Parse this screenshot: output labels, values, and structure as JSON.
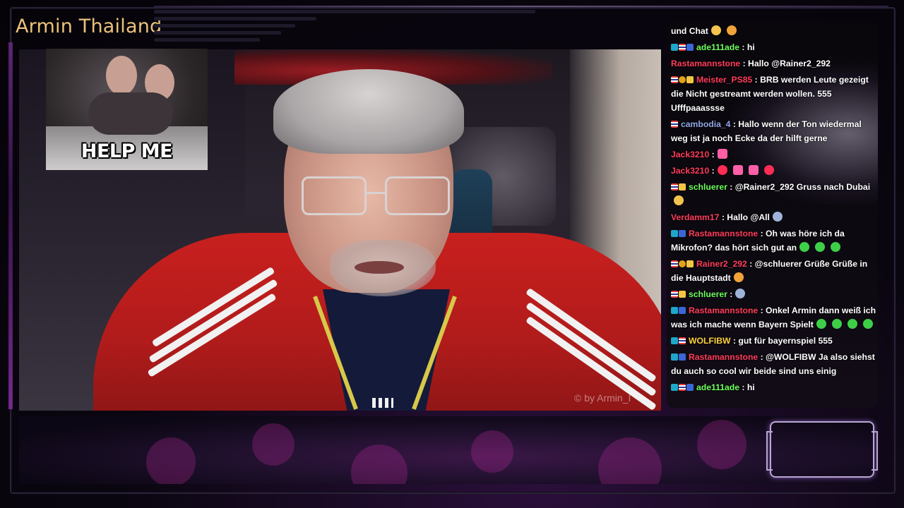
{
  "stream": {
    "title": "Armin Thailand",
    "watermark": "© by Armin_I",
    "gif_caption": "HELP ME"
  },
  "chat": {
    "messages": [
      {
        "badges": [],
        "user": "",
        "user_color": "#ffffff",
        "text": "und Chat",
        "emotes": [
          "e-hand",
          "e-face"
        ]
      },
      {
        "badges": [
          "b-cyan",
          "b-flag",
          "b-blue"
        ],
        "user": "ade111ade",
        "user_color": "#6bff5a",
        "text": ": hi",
        "emotes": []
      },
      {
        "badges": [],
        "user": "Rastamannstone",
        "user_color": "#ff3c5a",
        "text": ": Hallo @Rainer2_292",
        "emotes": []
      },
      {
        "badges": [
          "b-flag",
          "b-gold",
          "b-crown"
        ],
        "user": "Meister_PS85",
        "user_color": "#ff3c5a",
        "text": ": BRB werden Leute gezeigt die Nicht gestreamt werden wollen. 555 Ufffpaaassse",
        "emotes": []
      },
      {
        "badges": [
          "b-flag"
        ],
        "user": "cambodia_4",
        "user_color": "#8fa7e6",
        "text": ": Hallo wenn der Ton wiedermal weg ist ja noch Ecke da der hilft gerne",
        "emotes": []
      },
      {
        "badges": [],
        "user": "Jack3210",
        "user_color": "#ff3c5a",
        "text": ":",
        "emotes": [
          "e-pink"
        ]
      },
      {
        "badges": [],
        "user": "Jack3210",
        "user_color": "#ff3c5a",
        "text": ":",
        "emotes": [
          "e-red",
          "e-pink",
          "e-pink",
          "e-red"
        ]
      },
      {
        "badges": [
          "b-flag",
          "b-crown"
        ],
        "user": "schluerer",
        "user_color": "#6bff5a",
        "text": ": @Rainer2_292 Gruss nach Dubai",
        "emotes": [
          "e-hand"
        ]
      },
      {
        "badges": [],
        "user": "Verdamm17",
        "user_color": "#ff3c5a",
        "text": ": Hallo @All",
        "emotes": [
          "e-face2"
        ]
      },
      {
        "badges": [
          "b-cyan",
          "b-blue"
        ],
        "user": "Rastamannstone",
        "user_color": "#ff3c5a",
        "text": ": Oh was höre ich da Mikrofon? das hört sich gut an",
        "emotes": [
          "e-green",
          "e-green",
          "e-green"
        ]
      },
      {
        "badges": [
          "b-flag",
          "b-gold",
          "b-crown"
        ],
        "user": "Rainer2_292",
        "user_color": "#ff3c5a",
        "text": ": @schluerer Grüße Grüße in die Hauptstadt",
        "emotes": [
          "e-face"
        ]
      },
      {
        "badges": [
          "b-flag",
          "b-crown"
        ],
        "user": "schluerer",
        "user_color": "#6bff5a",
        "text": ":",
        "emotes": [
          "e-face2"
        ]
      },
      {
        "badges": [
          "b-cyan",
          "b-blue"
        ],
        "user": "Rastamannstone",
        "user_color": "#ff3c5a",
        "text": ": Onkel Armin dann weiß ich was ich mache wenn Bayern Spielt",
        "emotes": [
          "e-green",
          "e-green",
          "e-green",
          "e-green"
        ]
      },
      {
        "badges": [
          "b-cyan",
          "b-flag"
        ],
        "user": "WOLFIBW",
        "user_color": "#ffd23c",
        "text": ": gut für bayernspiel 555",
        "emotes": []
      },
      {
        "badges": [
          "b-cyan",
          "b-blue"
        ],
        "user": "Rastamannstone",
        "user_color": "#ff3c5a",
        "text": ": @WOLFIBW Ja also siehst du auch so cool wir beide sind uns einig",
        "emotes": []
      },
      {
        "badges": [
          "b-cyan",
          "b-flag",
          "b-blue"
        ],
        "user": "ade111ade",
        "user_color": "#6bff5a",
        "text": ": hi",
        "emotes": []
      }
    ]
  }
}
